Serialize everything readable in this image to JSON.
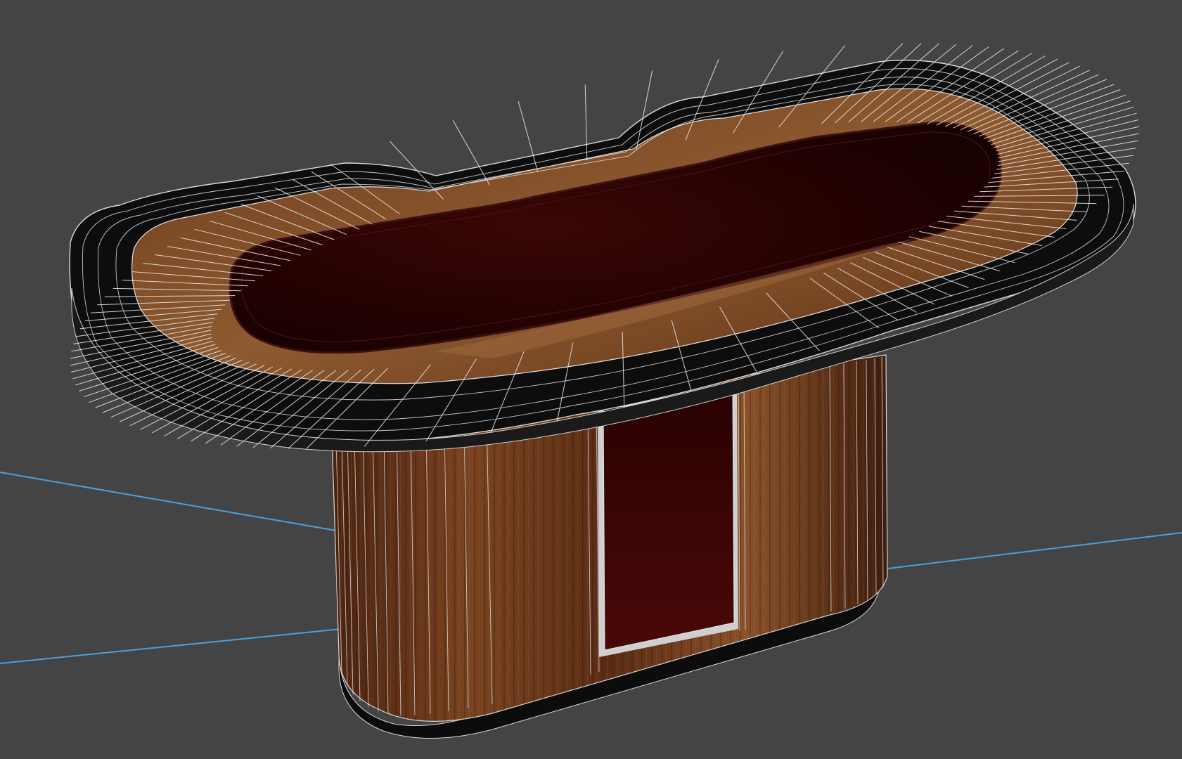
{
  "viewport": {
    "background_color": "#444444",
    "render_mode": "wireframe-over-shaded",
    "object": "poker-table",
    "colors": {
      "wireframe": "#e6e6e6",
      "grid_axis": "#4a9fe0",
      "felt": "#2a0303",
      "felt_highlight": "#4a0c08",
      "wood_light": "#8a4f2a",
      "wood_dark": "#3a1a0c",
      "bumper": "#0c0c0c",
      "door_panel": "#3d0505"
    }
  }
}
